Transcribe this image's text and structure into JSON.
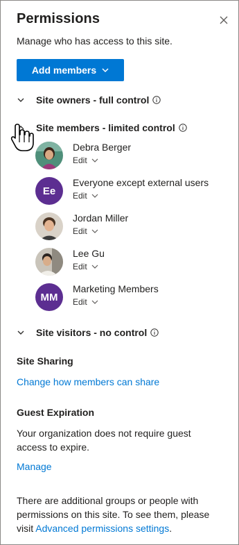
{
  "panel": {
    "title": "Permissions",
    "subtitle": "Manage who has access to this site.",
    "add_button_label": "Add members"
  },
  "sections": {
    "owners": "Site owners - full control",
    "members": "Site members - limited control",
    "visitors": "Site visitors - no control"
  },
  "members": [
    {
      "name": "Debra Berger",
      "role": "Edit"
    },
    {
      "name": "Everyone except external users",
      "role": "Edit",
      "initials": "Ee"
    },
    {
      "name": "Jordan Miller",
      "role": "Edit"
    },
    {
      "name": "Lee Gu",
      "role": "Edit"
    },
    {
      "name": "Marketing Members",
      "role": "Edit",
      "initials": "MM"
    }
  ],
  "site_sharing": {
    "heading": "Site Sharing",
    "link": "Change how members can share"
  },
  "guest_expiration": {
    "heading": "Guest Expiration",
    "text": "Your organization does not require guest access to expire.",
    "link": "Manage"
  },
  "footer": {
    "text": "There are additional groups or people with permissions on this site. To see them, please visit ",
    "link": "Advanced permissions settings",
    "end": "."
  },
  "colors": {
    "accent": "#0078d4",
    "initials_bg": "#5c2e91"
  }
}
